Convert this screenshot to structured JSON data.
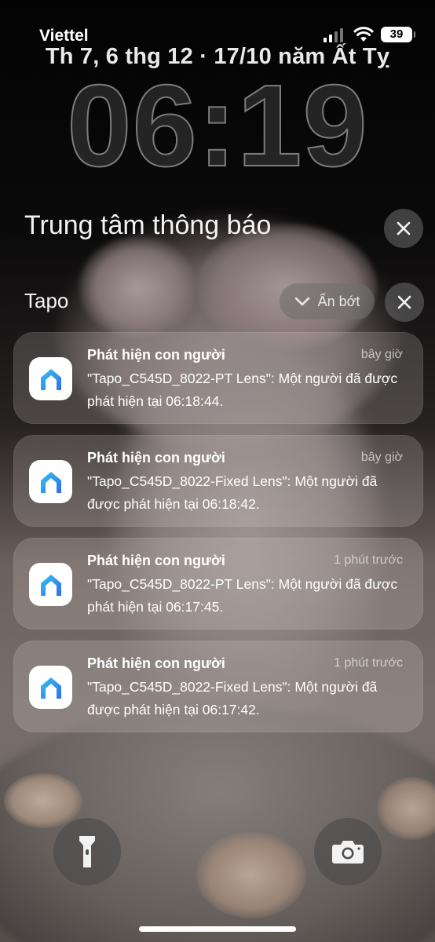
{
  "status_bar": {
    "carrier": "Viettel",
    "battery": "39",
    "icons": [
      "signal-icon",
      "wifi-icon",
      "battery-icon"
    ]
  },
  "lock_screen": {
    "date": "Th 7, 6 thg 12 · 17/10 năm Ất Tỵ",
    "time": "06:19"
  },
  "notification_center": {
    "title": "Trung tâm thông báo",
    "group": {
      "app_name": "Tapo",
      "show_less_label": "Ẩn bớt",
      "notifications": [
        {
          "title": "Phát hiện con người",
          "time": "bây giờ",
          "body": "\"Tapo_C545D_8022-PT Lens\": Một người đã được phát hiện tại 06:18:44."
        },
        {
          "title": "Phát hiện con người",
          "time": "bây giờ",
          "body": "\"Tapo_C545D_8022-Fixed Lens\": Một người đã được phát hiện tại 06:18:42."
        },
        {
          "title": "Phát hiện con người",
          "time": "1 phút trước",
          "body": "\"Tapo_C545D_8022-PT Lens\": Một người đã được phát hiện tại 06:17:45."
        },
        {
          "title": "Phát hiện con người",
          "time": "1 phút trước",
          "body": "\"Tapo_C545D_8022-Fixed Lens\": Một người đã được phát hiện tại 06:17:42."
        }
      ]
    }
  },
  "quick_actions": [
    "flashlight-icon",
    "camera-icon"
  ],
  "colors": {
    "app_icon_blue": "#2f80ee",
    "app_icon_cyan": "#35c3f0"
  }
}
